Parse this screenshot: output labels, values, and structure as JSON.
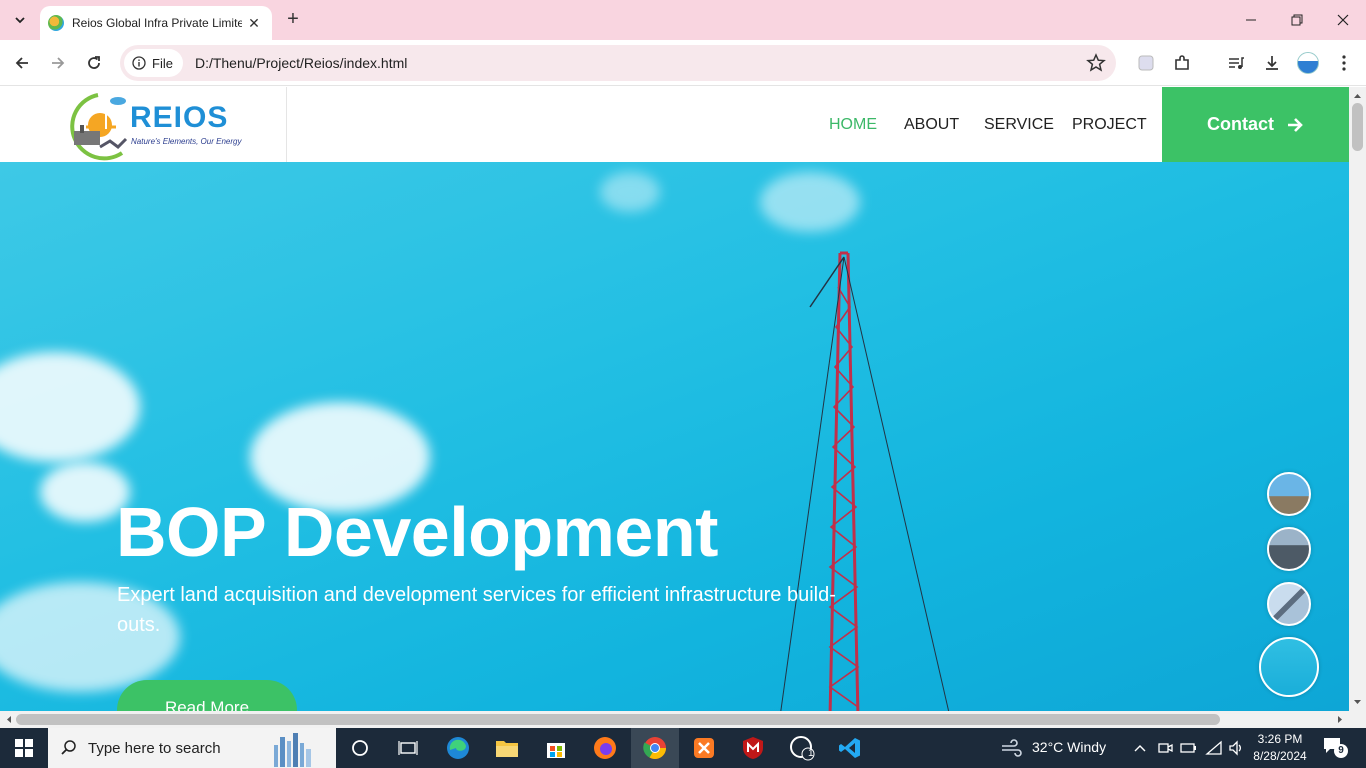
{
  "browser": {
    "tab_title": "Reios Global Infra Private Limite",
    "site_chip": "File",
    "url": "D:/Thenu/Project/Reios/index.html"
  },
  "site": {
    "logo_text": "REIOS",
    "logo_tagline": "Nature's Elements, Our Energy",
    "nav": [
      "HOME",
      "ABOUT",
      "SERVICE",
      "PROJECT"
    ],
    "active_nav": "HOME",
    "contact_label": "Contact",
    "accent_color": "#3cc266"
  },
  "hero": {
    "title": "BOP Development",
    "subtitle": "Expert land acquisition and development services for efficient infrastructure build-outs.",
    "button": "Read More"
  },
  "taskbar": {
    "search_placeholder": "Type here to search",
    "weather": "32°C  Windy",
    "time": "3:26 PM",
    "date": "8/28/2024",
    "whatsapp_badge": "1",
    "notification_count": "9"
  }
}
